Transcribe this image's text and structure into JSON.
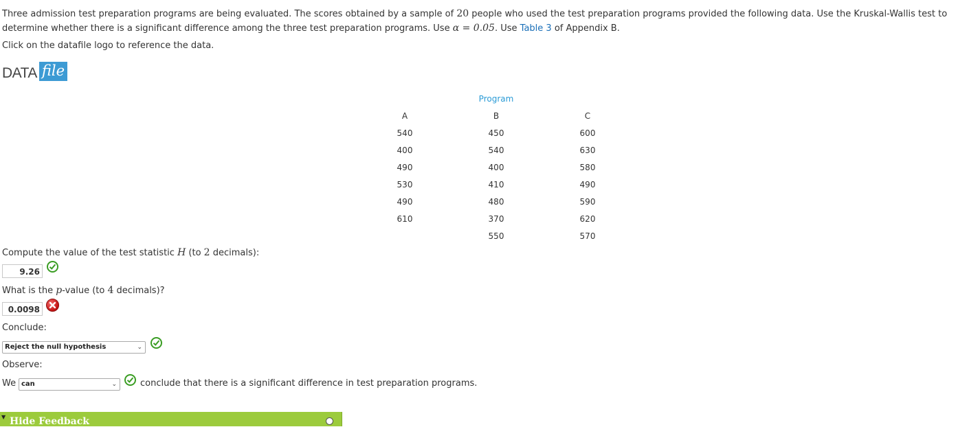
{
  "intro": {
    "p1": "Three admission test preparation programs are being evaluated. The scores obtained by a sample of ",
    "n": "20",
    "p2": " people who used the test preparation programs provided the following data. Use the Kruskal-Wallis test to determine whether there is a significant difference among the three test preparation programs. Use ",
    "alpha": "α = 0.05",
    "p3": ". Use ",
    "table_link": "Table 3",
    "p4": " of Appendix B."
  },
  "click_text": "Click on the datafile logo to reference the data.",
  "logo": {
    "data": "DATA",
    "file": "file"
  },
  "table": {
    "group_header": "Program",
    "columns": [
      "A",
      "B",
      "C"
    ],
    "A": [
      "540",
      "400",
      "490",
      "530",
      "490",
      "610"
    ],
    "B": [
      "450",
      "540",
      "400",
      "410",
      "480",
      "370",
      "550"
    ],
    "C": [
      "600",
      "630",
      "580",
      "490",
      "590",
      "620",
      "570"
    ]
  },
  "q1": {
    "pre": "Compute the value of the test statistic ",
    "var": "H",
    "mid": " (to ",
    "num": "2",
    "post": " decimals):",
    "answer": "9.26",
    "status": "correct"
  },
  "q2": {
    "pre": "What is the ",
    "var": "p",
    "post1": "-value (to ",
    "num": "4",
    "post2": " decimals)?",
    "answer": "0.0098",
    "status": "incorrect"
  },
  "conclude": {
    "label": "Conclude:",
    "selected": "Reject the null hypothesis",
    "status": "correct"
  },
  "observe": {
    "label": "Observe:",
    "pre": "We",
    "selected": "can",
    "post": "conclude that there is a significant difference in test preparation programs.",
    "status": "correct"
  },
  "feedback": {
    "label": "Hide Feedback"
  },
  "colors": {
    "correct": "#3a9d23",
    "incorrect": "#c41212",
    "feedback_bar": "#9ccb3c",
    "link": "#1a6fb8",
    "program": "#2b9bd6"
  },
  "icons": [
    "check-circle-icon",
    "x-circle-icon",
    "chevron-down-icon",
    "triangle-down-icon",
    "pencil-icon"
  ]
}
